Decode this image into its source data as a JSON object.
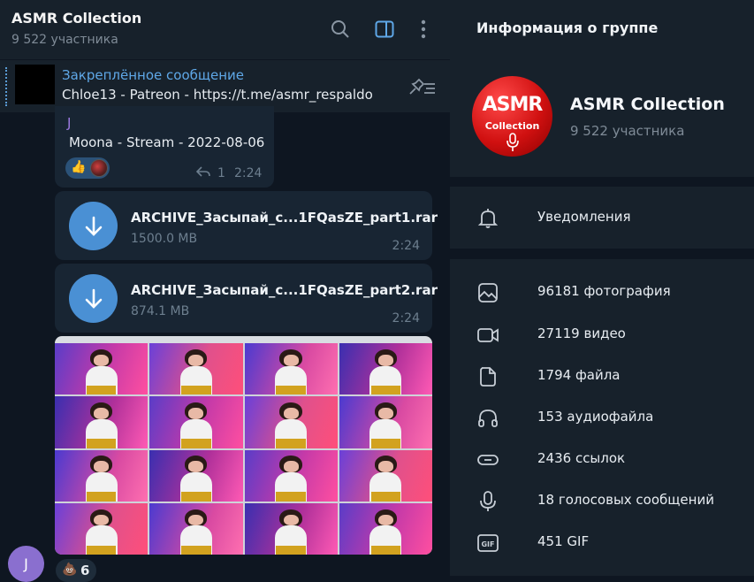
{
  "chat": {
    "title": "ASMR Collection",
    "subtitle": "9 522 участника",
    "pinned": {
      "label": "Закреплённое сообщение",
      "text": "Chloe13 - Patreon - https://t.me/asmr_respaldo"
    },
    "message1": {
      "author": "J",
      "text": "Moona - Stream - 2022-08-06",
      "reaction_emoji": "👍",
      "reply_count": "1",
      "time": "2:24"
    },
    "files": [
      {
        "name": "ARCHIVE_Засыпай_с...1FQasZE_part1.rar",
        "size": "1500.0 MB",
        "time": "2:24"
      },
      {
        "name": "ARCHIVE_Засыпай_с...1FQasZE_part2.rar",
        "size": "874.1 MB",
        "time": "2:24"
      }
    ],
    "sender_avatar_letter": "J",
    "bottom_reaction": {
      "emoji": "💩",
      "count": "6"
    }
  },
  "info": {
    "title": "Информация о группе",
    "group_name": "ASMR Collection",
    "group_sub": "9 522 участника",
    "avatar_text_main": "ASMR",
    "avatar_text_sub": "Collection",
    "notifications_label": "Уведомления",
    "media": [
      {
        "icon": "photo-icon",
        "label": "96181 фотография"
      },
      {
        "icon": "video-icon",
        "label": "27119 видео"
      },
      {
        "icon": "file-icon",
        "label": "1794 файла"
      },
      {
        "icon": "headphones-icon",
        "label": "153 аудиофайла"
      },
      {
        "icon": "link-icon",
        "label": "2436 ссылок"
      },
      {
        "icon": "microphone-icon",
        "label": "18 голосовых сообщений"
      },
      {
        "icon": "gif-icon",
        "label": "451 GIF"
      }
    ]
  },
  "colors": {
    "accent": "#5fa8e8",
    "panel": "#17212b",
    "background": "#0e1621",
    "bubble": "#182533",
    "download": "#4a90d4"
  }
}
